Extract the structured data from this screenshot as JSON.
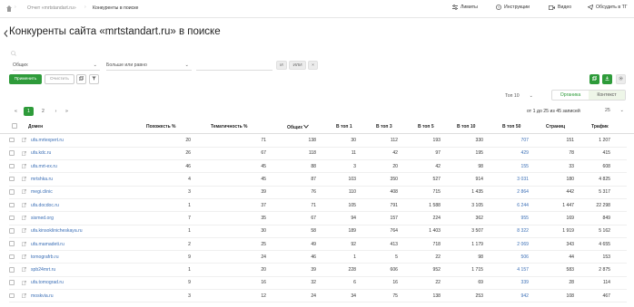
{
  "breadcrumb": {
    "items": [
      "Отчет «mrtstandart.ru»",
      "Конкуренты в поиске"
    ]
  },
  "topbar": {
    "limits": "Лимиты",
    "instructions": "Инструкции",
    "video": "Видео",
    "feedback": "Обсудить в ТГ"
  },
  "page": {
    "title": "Конкуренты сайта «mrtstandart.ru» в поиске"
  },
  "filters": {
    "field_select": "Общих",
    "condition_select": "Больше или равно",
    "and_label": "И",
    "or_label": "ИЛИ",
    "remove_label": "×",
    "apply_label": "Применить",
    "clear_label": "Очистить"
  },
  "controls": {
    "top_select": "Топ 10",
    "toggle_organic": "Органика",
    "toggle_context": "Контекст",
    "records_info": "от 1 до 25 из 45 записей",
    "per_page": "25"
  },
  "pagination": {
    "first": "«",
    "prev": "‹",
    "pages": [
      "1",
      "2"
    ],
    "next": "›",
    "last": "»",
    "current": "1"
  },
  "colors": {
    "accent": "#2e9b3a",
    "link": "#3b6fb6"
  },
  "table": {
    "headers": [
      "Домен",
      "Похожесть %",
      "Тематичность %",
      "Общих",
      "В топ 1",
      "В топ 3",
      "В топ 5",
      "В топ 10",
      "В топ 50",
      "Страниц",
      "Трафик"
    ],
    "rows": [
      [
        "ufa.mrtexpert.ru",
        "20",
        "71",
        "138",
        "30",
        "112",
        "193",
        "330",
        "707",
        "151",
        "1 207"
      ],
      [
        "ufa.kdc.ru",
        "26",
        "67",
        "118",
        "11",
        "42",
        "97",
        "195",
        "429",
        "78",
        "415"
      ],
      [
        "ufa.mrt-ex.ru",
        "46",
        "45",
        "88",
        "3",
        "20",
        "42",
        "98",
        "155",
        "33",
        "608"
      ],
      [
        "mrtshka.ru",
        "4",
        "45",
        "87",
        "103",
        "350",
        "527",
        "914",
        "3 031",
        "180",
        "4 825"
      ],
      [
        "megi.clinic",
        "3",
        "39",
        "76",
        "110",
        "408",
        "715",
        "1 435",
        "2 864",
        "442",
        "5 317"
      ],
      [
        "ufa.docdoc.ru",
        "1",
        "37",
        "71",
        "105",
        "791",
        "1 588",
        "3 105",
        "6 244",
        "1 447",
        "22 298"
      ],
      [
        "sismed.org",
        "7",
        "35",
        "67",
        "94",
        "157",
        "224",
        "362",
        "955",
        "169",
        "849"
      ],
      [
        "ufa.kinsoklinicheskaya.ru",
        "1",
        "30",
        "58",
        "189",
        "764",
        "1 403",
        "3 507",
        "8 322",
        "1 919",
        "5 162"
      ],
      [
        "ufa.mamadeti.ru",
        "2",
        "25",
        "49",
        "92",
        "413",
        "718",
        "1 179",
        "2 069",
        "343",
        "4 655"
      ],
      [
        "tomografrb.ru",
        "9",
        "24",
        "46",
        "1",
        "5",
        "22",
        "98",
        "506",
        "44",
        "153"
      ],
      [
        "spb24mrt.ru",
        "1",
        "20",
        "39",
        "228",
        "606",
        "952",
        "1 715",
        "4 157",
        "583",
        "2 875"
      ],
      [
        "ufa.tomograd.ru",
        "9",
        "16",
        "32",
        "6",
        "16",
        "22",
        "69",
        "339",
        "28",
        "114"
      ],
      [
        "moskvia.ru",
        "3",
        "12",
        "24",
        "34",
        "75",
        "138",
        "253",
        "942",
        "108",
        "467"
      ]
    ]
  }
}
